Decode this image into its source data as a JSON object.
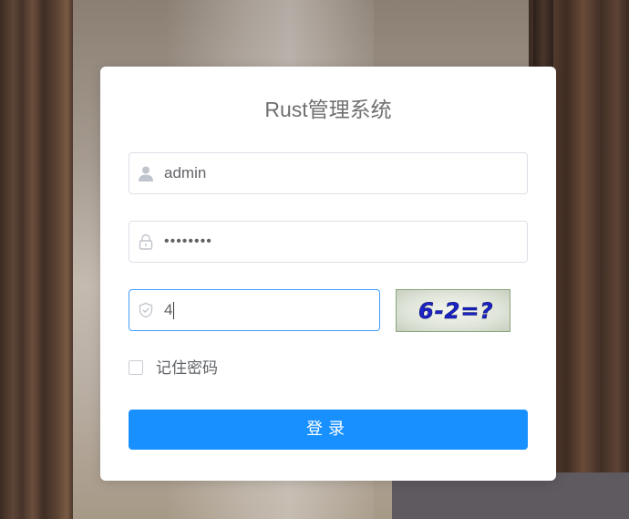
{
  "title": "Rust管理系统",
  "username": {
    "value": "admin",
    "icon": "user-icon"
  },
  "password": {
    "value": "••••••••",
    "icon": "lock-icon"
  },
  "captcha_input": {
    "value": "4",
    "icon": "shield-check-icon"
  },
  "captcha_image": {
    "text": "6-2=?"
  },
  "remember": {
    "label": "记住密码",
    "checked": false
  },
  "login_button": {
    "label": "登录"
  },
  "colors": {
    "primary": "#1890ff",
    "focus_border": "#409eff",
    "captcha_text": "#1a24c8"
  }
}
